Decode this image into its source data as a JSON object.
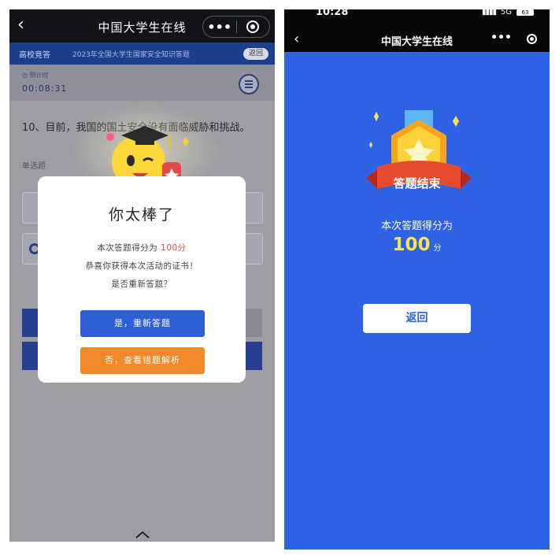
{
  "left_screen": {
    "nav": {
      "back_glyph": "‹",
      "title": "中国大学生在线",
      "more_glyph": "•••"
    },
    "tabbar": {
      "section": "高校竞答",
      "quiz_title": "2023年全国大学生国家安全知识答题",
      "return_label": "返回"
    },
    "timer": {
      "label": "倒计时",
      "value": "00:08:31"
    },
    "question": {
      "text": "10、目前，我国的国土安全没有面临威胁和挑战。",
      "type": "单选题"
    },
    "modal": {
      "title": "你太棒了",
      "line1_prefix": "本次答题得分为",
      "line1_score": "100分",
      "line2": "恭喜你获得本次活动的证书！",
      "line3": "是否重新答题？",
      "btn_yes": "是，重新答题",
      "btn_no": "否，查看错题解析"
    }
  },
  "right_screen": {
    "status": {
      "time": "10:28",
      "network": "5G",
      "battery": "63"
    },
    "nav": {
      "back_glyph": "‹",
      "title": "中国大学生在线",
      "more_glyph": "•••"
    },
    "badge_label": "答题结束",
    "score_label": "本次答题得分为",
    "score_value": "100",
    "score_unit": "分",
    "return_button": "返回"
  },
  "colors": {
    "primary_blue": "#2f5ed8",
    "orange": "#f08a28",
    "right_bg": "#2f63e5",
    "score_yellow": "#ffe14a",
    "score_red": "#d84d3b"
  }
}
